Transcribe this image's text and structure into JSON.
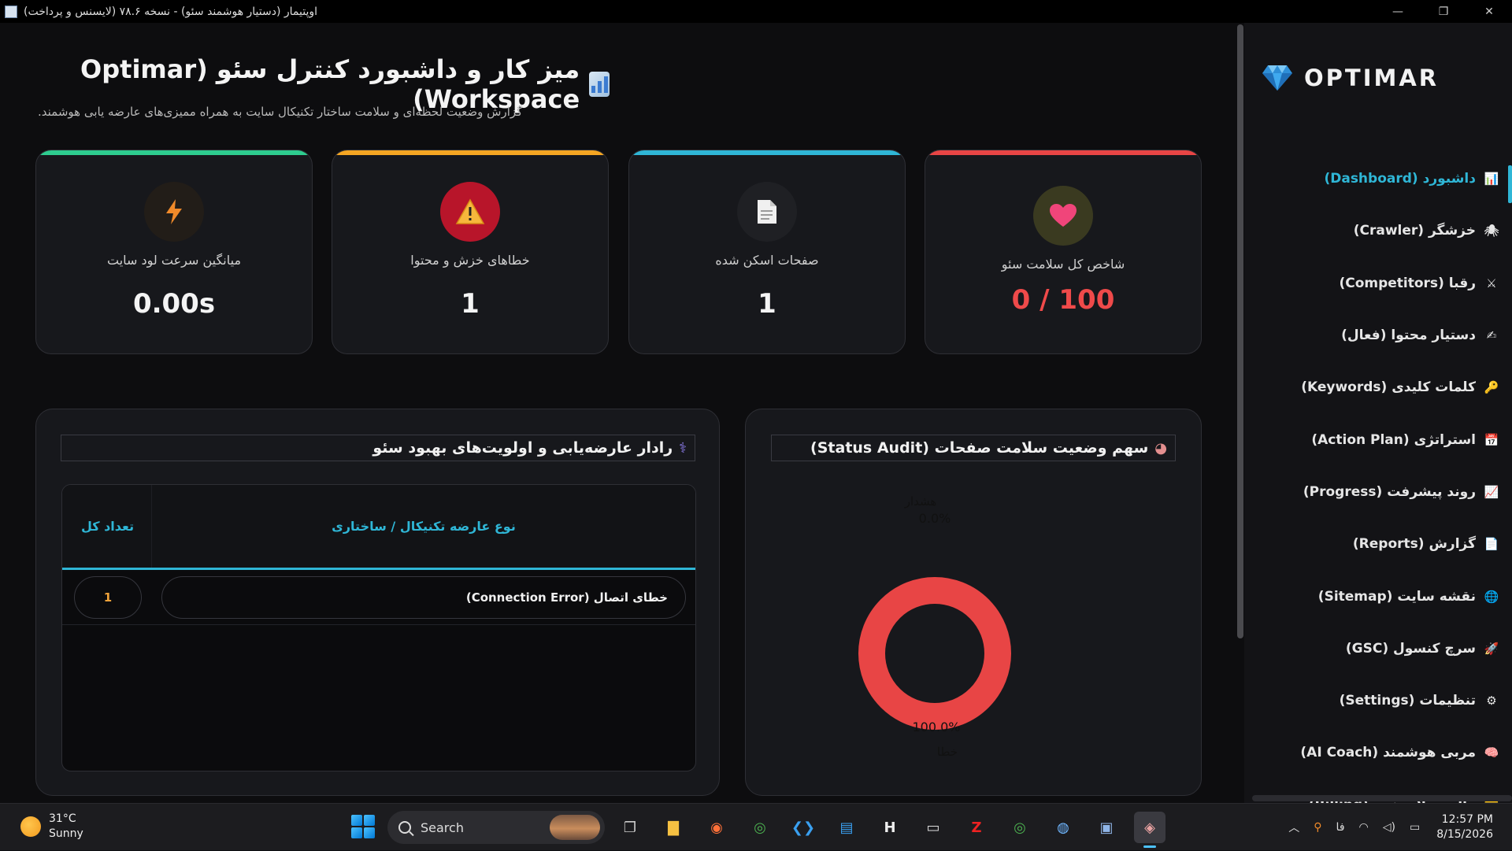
{
  "window": {
    "title": "اوپتیمار (دستیار هوشمند سئو) - نسخه ۷۸.۶ (لایسنس و پرداخت)",
    "minimize": "—",
    "maximize": "❐",
    "close": "✕"
  },
  "header": {
    "title": "میز کار و داشبورد کنترل سئو (Optimar Workspace)",
    "subtitle": "گزارش وضعیت لحظه‌ای و سلامت ساختار تکنیکال سایت به همراه ممیزی‌های عارضه یابی هوشمند."
  },
  "cards": [
    {
      "label": "شاخص کل سلامت سئو",
      "value": "0 / 100",
      "icon": "heart-icon",
      "accent": "#e84545"
    },
    {
      "label": "صفحات اسکن شده",
      "value": "1",
      "icon": "document-icon",
      "accent": "#2fb6d6"
    },
    {
      "label": "خطاهای خزش و محتوا",
      "value": "1",
      "icon": "warning-icon",
      "accent": "#f5a623"
    },
    {
      "label": "میانگین سرعت لود سایت",
      "value": "0.00s",
      "icon": "lightning-icon",
      "accent": "#2ecc8f"
    }
  ],
  "radar": {
    "title": "رادار عارضه‌یابی و اولویت‌های بهبود سئو",
    "icon": "stethoscope-icon",
    "columns": {
      "type": "نوع عارضه تکنیکال / ساختاری",
      "count": "تعداد کل"
    },
    "rows": [
      {
        "type": "خطای اتصال (Connection Error)",
        "count": "1"
      }
    ]
  },
  "status_audit": {
    "title": "سهم وضعیت سلامت صفحات (Status Audit)",
    "icon": "pie-icon"
  },
  "chart_data": {
    "type": "pie",
    "categories": [
      "هشدار",
      "خطا"
    ],
    "values": [
      0.0,
      100.0
    ],
    "labels": [
      "0.0%",
      "100.0%"
    ],
    "colors": [
      "#f5a623",
      "#e84545"
    ],
    "title": ""
  },
  "sidebar": {
    "brand": "OPTIMAR",
    "items": [
      {
        "label": "داشبورد (Dashboard)",
        "icon": "📊",
        "active": true
      },
      {
        "label": "خزشگر (Crawler)",
        "icon": "🕷"
      },
      {
        "label": "رقبا (Competitors)",
        "icon": "⚔"
      },
      {
        "label": "دستیار محتوا (فعال)",
        "icon": "✍"
      },
      {
        "label": "کلمات کلیدی (Keywords)",
        "icon": "🔑"
      },
      {
        "label": "استراتژی (Action Plan)",
        "icon": "📅"
      },
      {
        "label": "روند پیشرفت (Progress)",
        "icon": "📈"
      },
      {
        "label": "گزارش (Reports)",
        "icon": "📄"
      },
      {
        "label": "نقشه سایت (Sitemap)",
        "icon": "🌐"
      },
      {
        "label": "سرچ کنسول (GSC)",
        "icon": "🚀"
      },
      {
        "label": "تنظیمات (Settings)",
        "icon": "⚙"
      },
      {
        "label": "مربی هوشمند (AI Coach)",
        "icon": "🧠"
      },
      {
        "label": "مالی و لایسنس (Billing)",
        "icon": "💳"
      }
    ]
  },
  "taskbar": {
    "weather_temp": "31°C",
    "weather_desc": "Sunny",
    "search_label": "Search",
    "lang": "فا",
    "time": "12:57 PM",
    "date": "8/15/2026"
  }
}
